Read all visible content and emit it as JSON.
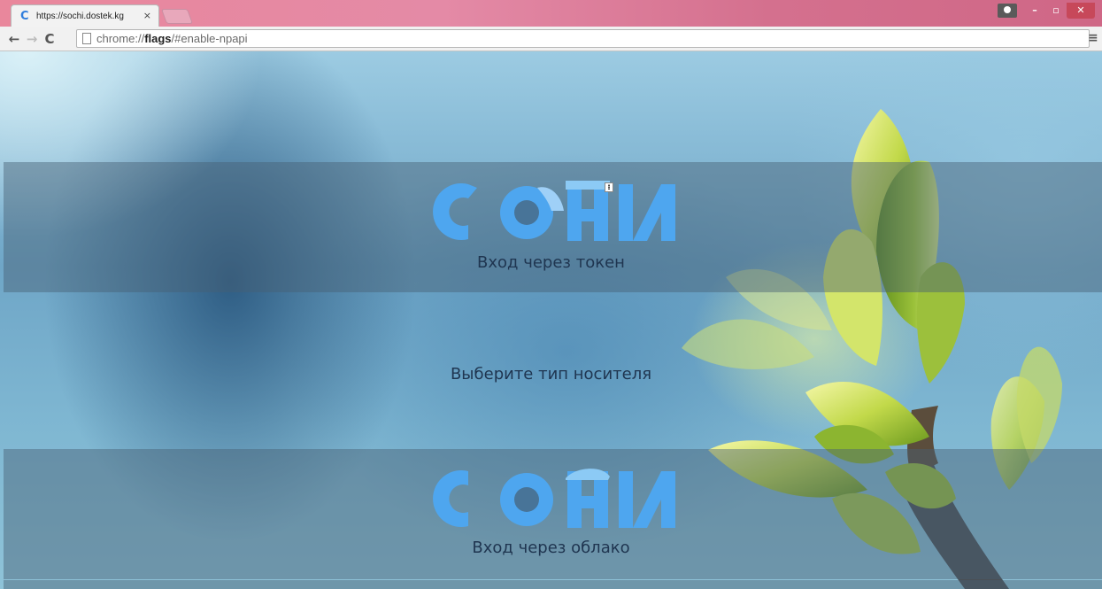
{
  "browser": {
    "tab_title": "https://sochi.dostek.kg",
    "tab_close": "×",
    "favicon_letter": "C",
    "url_prefix": "chrome://",
    "url_bold": "flags",
    "url_suffix": "/#enable-npapi",
    "title_bar_color": "#e48aa6"
  },
  "page": {
    "logo_text": "СОЧИ",
    "token_login": "Вход через токен",
    "choose_media": "Выберите тип носителя",
    "cloud_login": "Вход через облако",
    "logo_color": "#4ea6ef"
  },
  "icons": [
    "back-icon",
    "forward-icon",
    "reload-icon",
    "page-icon",
    "menu-icon",
    "user-icon",
    "minimize-icon",
    "maximize-icon",
    "close-icon"
  ]
}
